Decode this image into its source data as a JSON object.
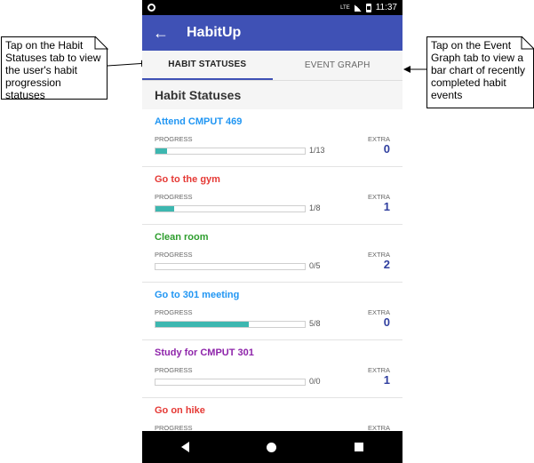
{
  "annotations": {
    "left": "Tap on the Habit Statuses tab to view the user's habit progression statuses",
    "right": "Tap on the Event Graph tab to view a bar chart of recently completed habit events"
  },
  "status_bar": {
    "network": "LTE",
    "time": "11:37"
  },
  "app_bar": {
    "title": "HabitUp"
  },
  "tabs": [
    {
      "label": "HABIT STATUSES"
    },
    {
      "label": "EVENT GRAPH"
    }
  ],
  "section_title": "Habit Statuses",
  "labels": {
    "progress": "PROGRESS",
    "extra": "EXTRA"
  },
  "habits": [
    {
      "name": "Attend CMPUT 469",
      "color": "#2196f3",
      "progress_fraction": 0.08,
      "progress_text": "1/13",
      "extra": "0"
    },
    {
      "name": "Go to the gym",
      "color": "#e53935",
      "progress_fraction": 0.125,
      "progress_text": "1/8",
      "extra": "1"
    },
    {
      "name": "Clean room",
      "color": "#2e9e2e",
      "progress_fraction": 0.0,
      "progress_text": "0/5",
      "extra": "2"
    },
    {
      "name": "Go to 301 meeting",
      "color": "#2196f3",
      "progress_fraction": 0.625,
      "progress_text": "5/8",
      "extra": "0"
    },
    {
      "name": "Study for CMPUT 301",
      "color": "#8e24aa",
      "progress_fraction": 0.0,
      "progress_text": "0/0",
      "extra": "1"
    },
    {
      "name": "Go on hike",
      "color": "#e53935",
      "progress_fraction": 0.0,
      "progress_text": "",
      "extra": ""
    }
  ],
  "colors": {
    "app_bar": "#3f51b5",
    "progress_fill": "#3db7b0",
    "extra_value": "#303f9f"
  },
  "icons": {
    "back": "arrow-back-icon",
    "nav": [
      "nav-back-icon",
      "nav-home-icon",
      "nav-recents-icon"
    ]
  }
}
